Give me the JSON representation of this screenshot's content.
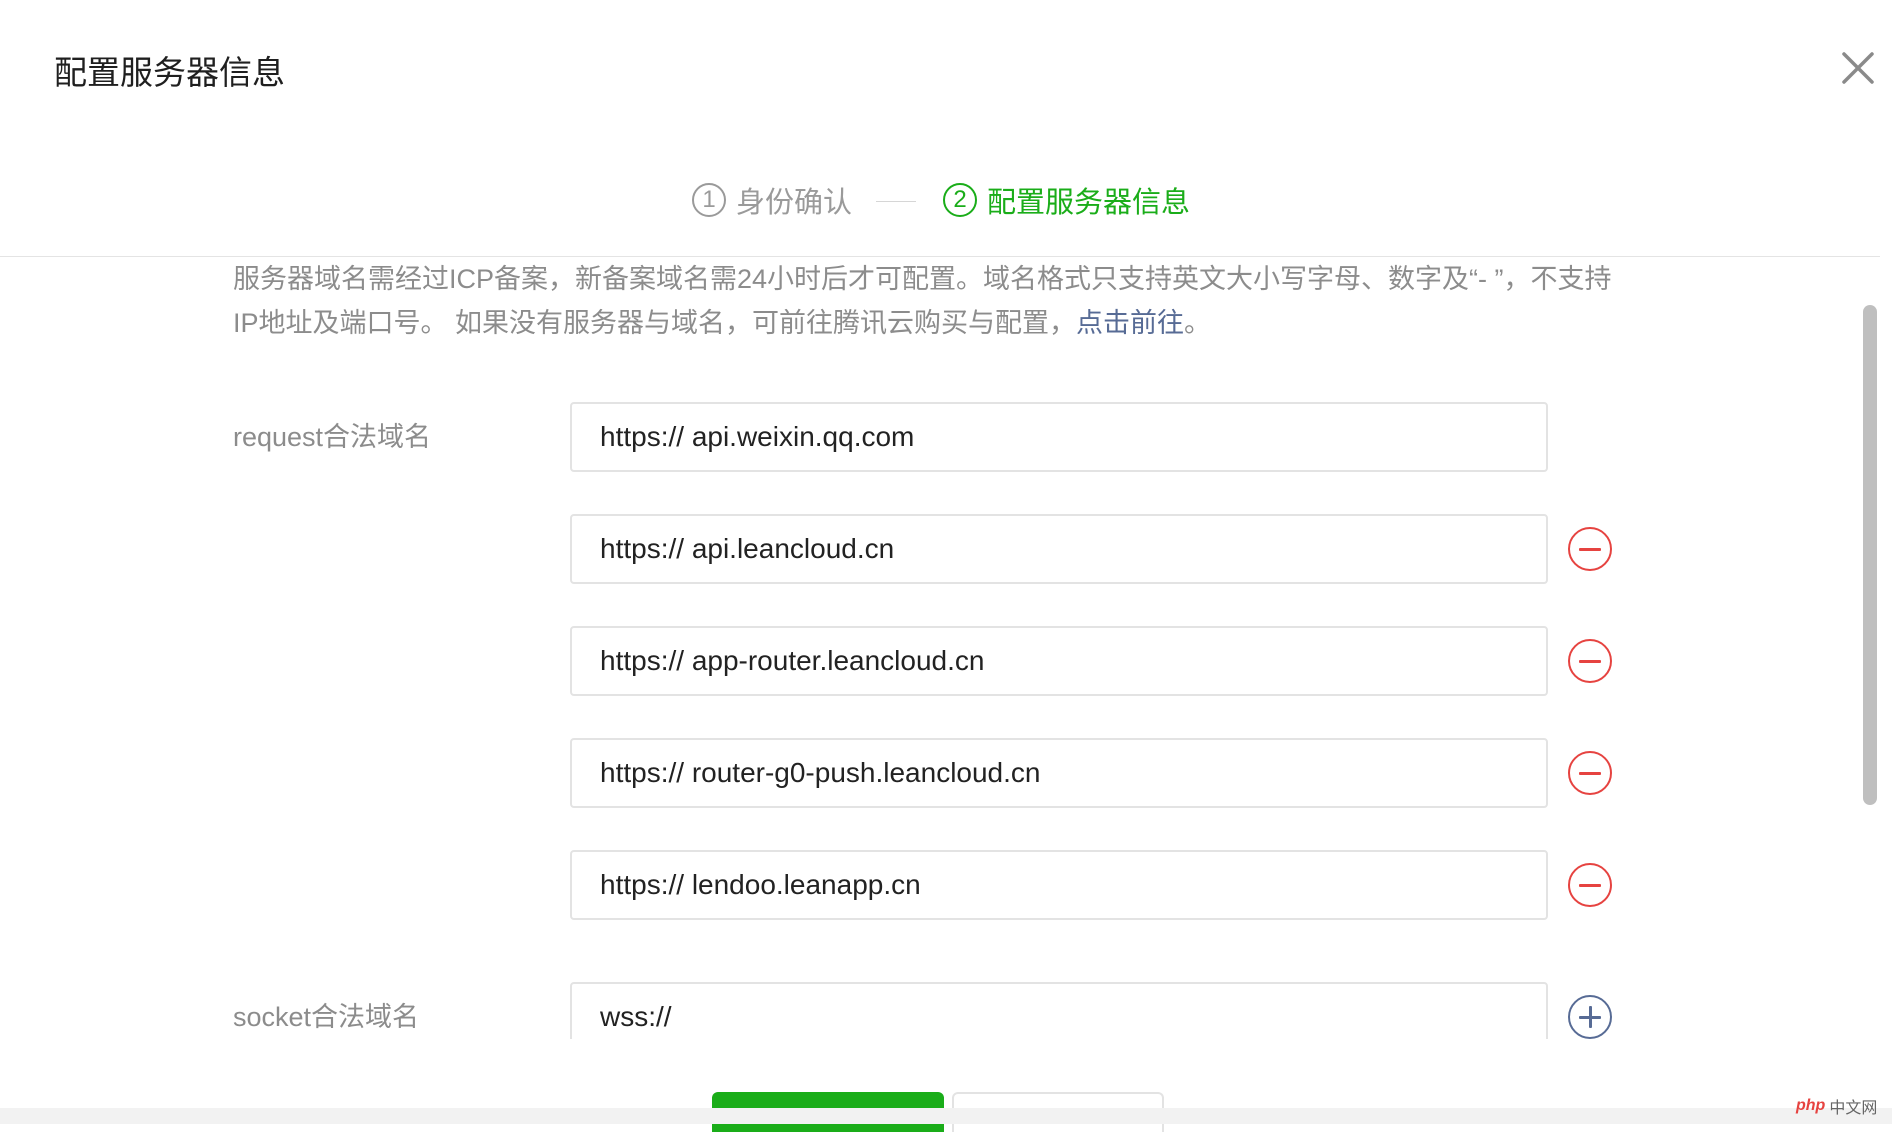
{
  "dialog": {
    "title": "配置服务器信息"
  },
  "steps": [
    {
      "num": "1",
      "label": "身份确认",
      "state": "done"
    },
    {
      "num": "2",
      "label": "配置服务器信息",
      "state": "active"
    }
  ],
  "notice": {
    "text": "服务器域名需经过ICP备案，新备案域名需24小时后才可配置。域名格式只支持英文大小写字母、数字及“- ”，不支持IP地址及端口号。 如果没有服务器与域名，可前往腾讯云购买与配置，",
    "link": "点击前往",
    "suffix": "。"
  },
  "request": {
    "label": "request合法域名",
    "domains": [
      "https:// api.weixin.qq.com",
      "https:// api.leancloud.cn",
      "https:// app-router.leancloud.cn",
      "https:// router-g0-push.leancloud.cn",
      "https:// lendoo.leanapp.cn"
    ]
  },
  "socket": {
    "label": "socket合法域名",
    "value": "wss://"
  },
  "watermark": {
    "logo": "php",
    "text": "中文网"
  },
  "colors": {
    "accent_green": "#1aad19",
    "link_blue": "#576b95",
    "remove_red": "#e64340"
  }
}
